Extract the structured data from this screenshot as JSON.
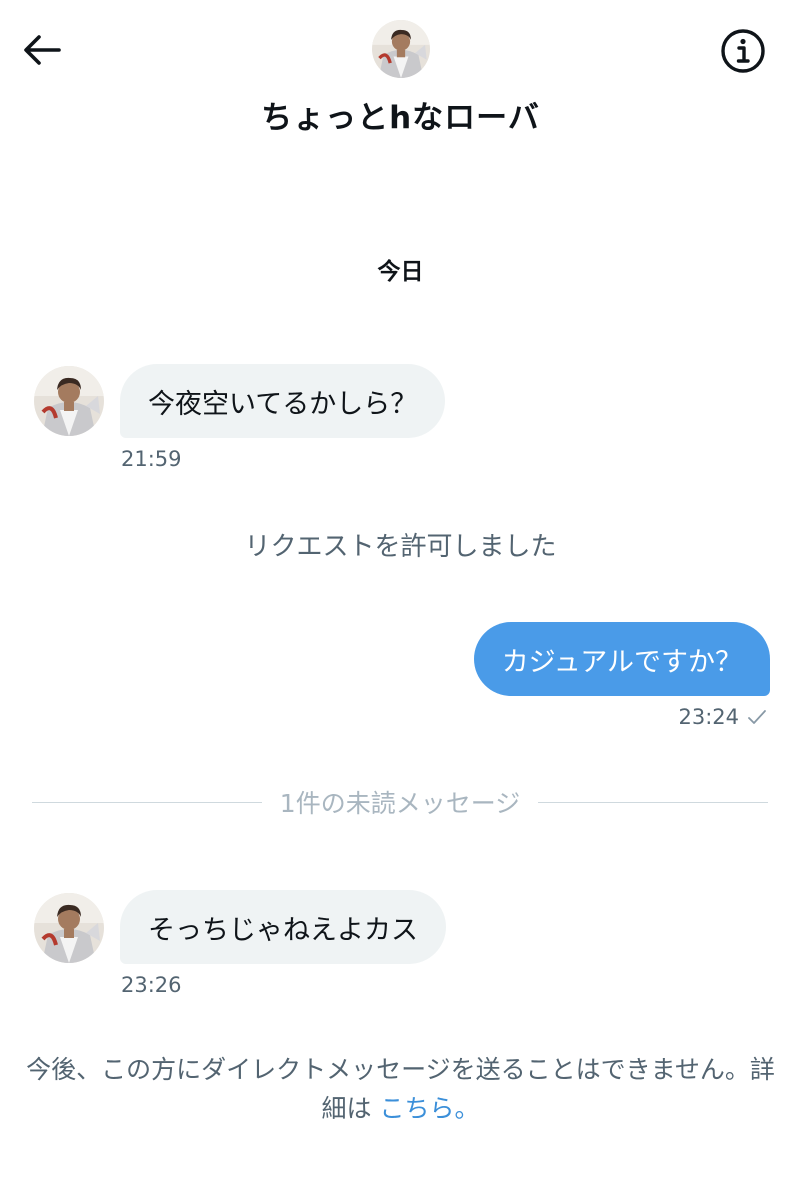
{
  "header": {
    "title": "ちょっとhなローバ",
    "back_icon": "back-arrow-icon",
    "info_icon": "info-icon"
  },
  "date_separator": "今日",
  "messages": [
    {
      "direction": "incoming",
      "text": "今夜空いてるかしら？",
      "time": "21:59"
    },
    {
      "direction": "outgoing",
      "text": "カジュアルですか？",
      "time": "23:24",
      "status_icon": "check-icon"
    },
    {
      "direction": "incoming",
      "text": "そっちじゃねえよカス",
      "time": "23:26"
    }
  ],
  "system_message": "リクエストを許可しました",
  "unread_divider": "1件の未読メッセージ",
  "footer": {
    "notice": "今後、この方にダイレクトメッセージを送ることはできません。詳細は ",
    "link": "こちら。"
  },
  "colors": {
    "outgoing_bubble": "#4a9be8",
    "incoming_bubble": "#eff3f4",
    "link": "#3b8fd9"
  }
}
